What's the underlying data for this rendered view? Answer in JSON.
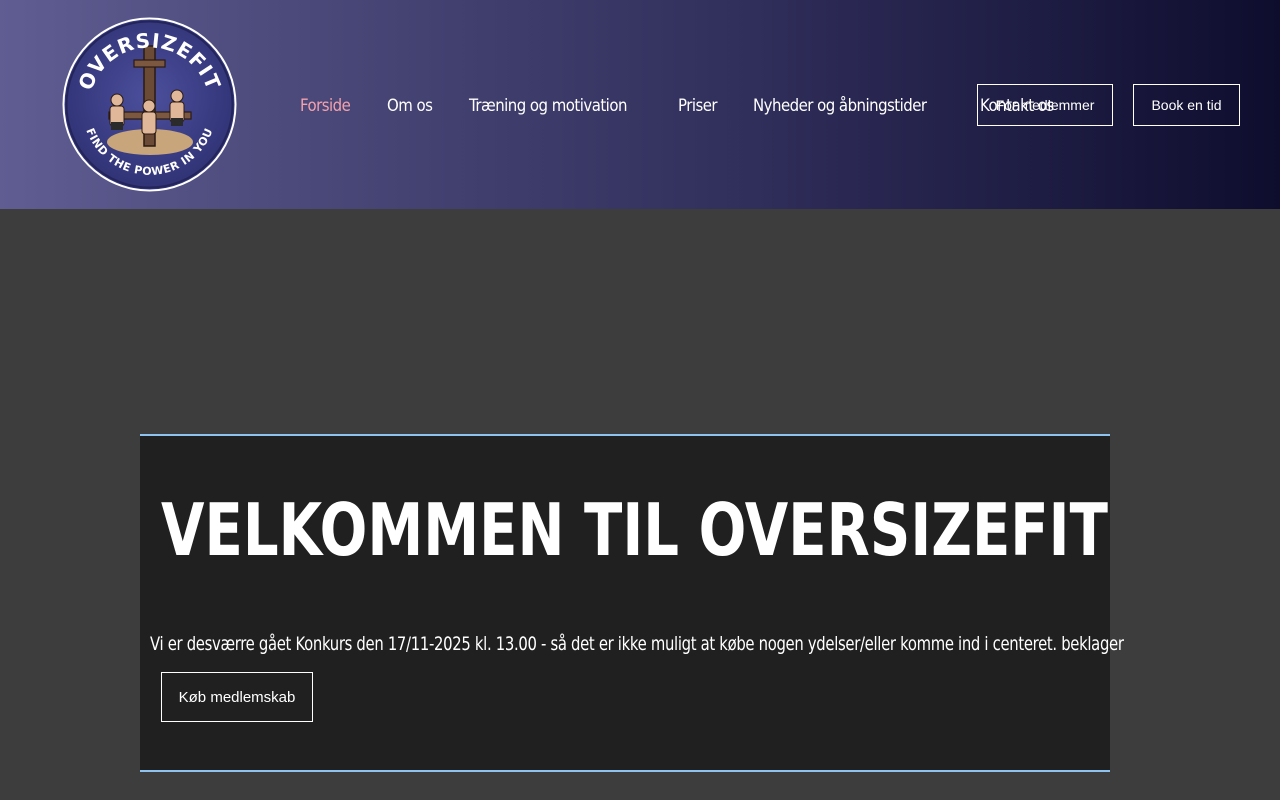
{
  "header": {
    "logo": {
      "top_text": "OVERSIZEFIT",
      "bottom_text": "FIND THE POWER IN YOU"
    },
    "nav": [
      {
        "label": "Forside",
        "active": true
      },
      {
        "label": "Om os",
        "active": false
      },
      {
        "label": "Træning og motivation",
        "active": false
      },
      {
        "label": "Priser",
        "active": false
      },
      {
        "label": "Nyheder og åbningstider",
        "active": false
      },
      {
        "label": "Kontakt os",
        "active": false
      }
    ],
    "members_button": "For medlemmer",
    "book_button": "Book en tid"
  },
  "hero": {
    "title": "VELKOMMEN TIL OVERSIZEFIT",
    "notice": "Vi er desværre gået Konkurs den 17/11-2025 kl. 13.00 - så det er ikke muligt at købe nogen ydelser/eller komme ind i centeret. beklager",
    "cta_button": "Køb medlemskab"
  },
  "colors": {
    "active_nav": "#f3a1ad",
    "hero_border": "#8fc3ef",
    "hero_bg": "#202020",
    "page_bg": "#3d3d3d"
  }
}
